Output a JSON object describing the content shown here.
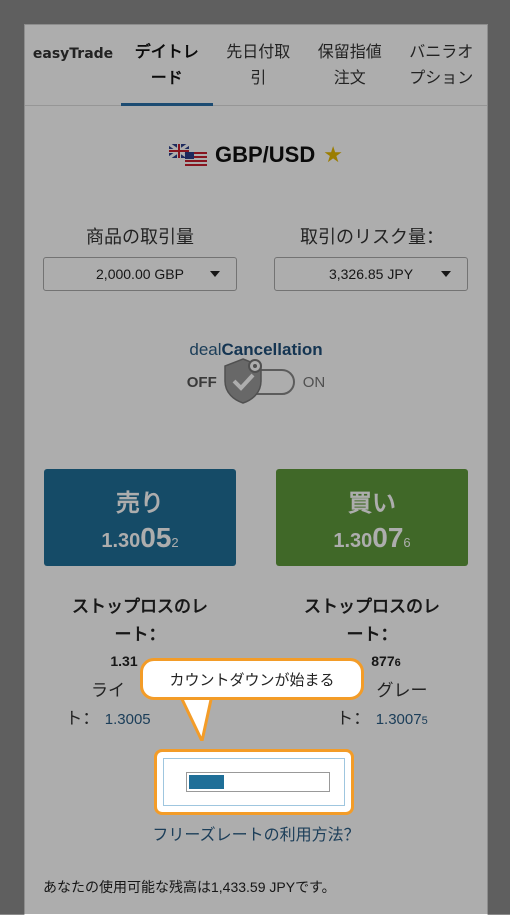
{
  "tabs": [
    {
      "label": "easyTrade",
      "active": false
    },
    {
      "label": "デイトレ\nード",
      "active": true
    },
    {
      "label": "先日付取\n引",
      "active": false
    },
    {
      "label": "保留指値\n注文",
      "active": false
    },
    {
      "label": "バニラオ\nプション",
      "active": false
    }
  ],
  "instrument": {
    "pair": "GBP/USD",
    "flag_icon": "uk-us-flag-icon",
    "favorite_icon": "star-icon"
  },
  "amount": {
    "label": "商品の取引量",
    "value": "2,000.00 GBP"
  },
  "risk": {
    "label": "取引のリスク量：",
    "value": "3,326.85 JPY"
  },
  "deal_cancellation": {
    "prefix": "deal",
    "bold": "Cancellation",
    "off": "OFF",
    "on": "ON",
    "state": "off"
  },
  "sell": {
    "label": "売り",
    "price_main": "1.30",
    "price_big": "05",
    "price_small": "2"
  },
  "buy": {
    "label": "買い",
    "price_main": "1.30",
    "price_big": "07",
    "price_small": "6"
  },
  "stop_loss_left": {
    "label": "ストップロスのレ\nート：",
    "value": "1.31"
  },
  "stop_loss_right": {
    "label": "ストップロスのレ\nート：",
    "value": "877",
    "value_small": "6"
  },
  "limit_left": {
    "label": "ライ",
    "line2": "ト：",
    "value": "1.3005"
  },
  "limit_right": {
    "label": "グレー",
    "line2": "ト：",
    "value": "1.3007",
    "value_small": "5"
  },
  "tooltip": {
    "text": "カウントダウンが始まる"
  },
  "countdown": {
    "progress": 0.25
  },
  "howto": {
    "text": "フリーズレートの利用方法？"
  },
  "balance": {
    "prefix": "あなたの使用可能な残高は",
    "amount": "1,433.59 JPY",
    "suffix": "です。"
  },
  "colors": {
    "sell": "#1f6f98",
    "buy": "#5f9a3c",
    "accent": "#f39c28",
    "tab_underline": "#2a6fa8"
  }
}
